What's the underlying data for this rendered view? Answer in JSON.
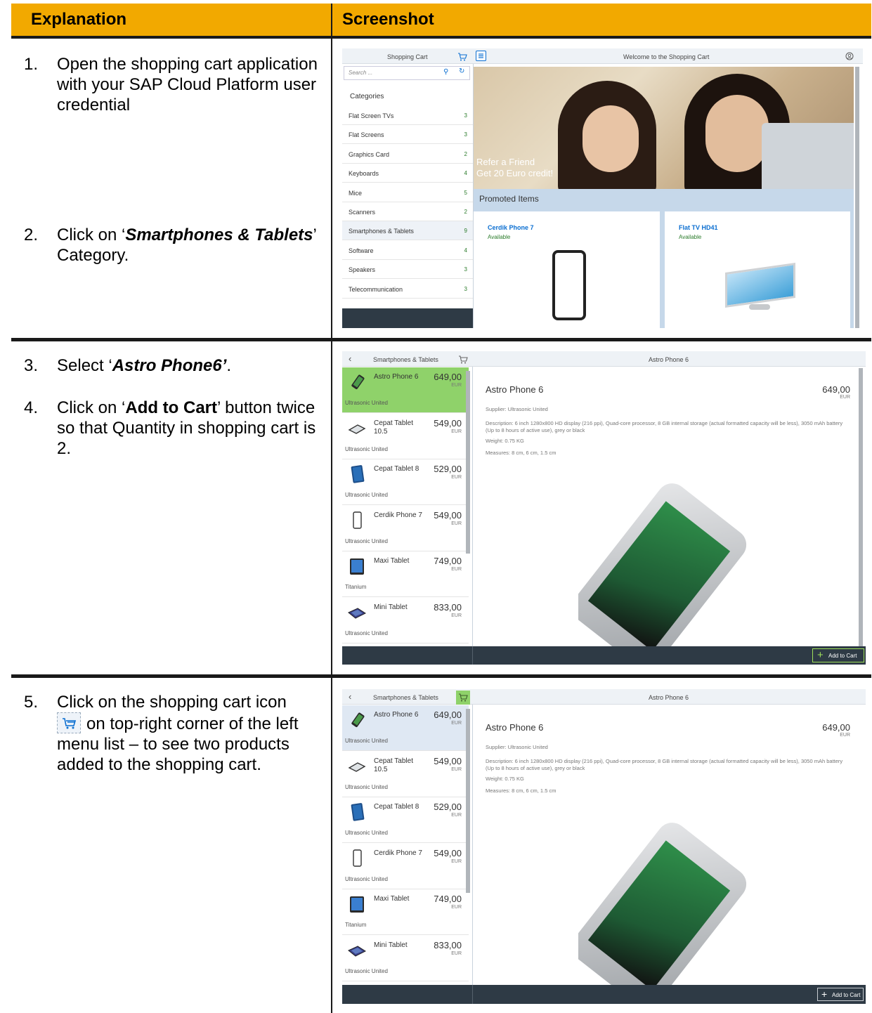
{
  "table": {
    "col1": "Explanation",
    "col2": "Screenshot"
  },
  "steps": [
    {
      "num": "1.",
      "text": "Open the shopping cart application with your SAP Cloud Platform user credential"
    },
    {
      "num": "2.",
      "pre": "Click on ‘",
      "em": "Smartphones & Tablets",
      "post": "’ Category."
    },
    {
      "num": "3.",
      "pre": "Select ‘",
      "em": "Astro Phone6’",
      "post": "."
    },
    {
      "num": "4.",
      "pre": "Click on ‘",
      "strong": "Add to Cart",
      "post": "’ button twice so that Quantity in shopping cart is 2."
    },
    {
      "num": "5.",
      "pre": "Click on the shopping cart icon",
      "post": "on top-right corner of the left menu list – to see two products added to the shopping cart."
    }
  ],
  "shot1": {
    "side_title": "Shopping Cart",
    "main_title": "Welcome to the Shopping Cart",
    "search_placeholder": "Search ...",
    "categories_label": "Categories",
    "categories": [
      {
        "name": "Flat Screen TVs",
        "count": "3"
      },
      {
        "name": "Flat Screens",
        "count": "3"
      },
      {
        "name": "Graphics Card",
        "count": "2"
      },
      {
        "name": "Keyboards",
        "count": "4"
      },
      {
        "name": "Mice",
        "count": "5"
      },
      {
        "name": "Scanners",
        "count": "2"
      },
      {
        "name": "Smartphones & Tablets",
        "count": "9"
      },
      {
        "name": "Software",
        "count": "4"
      },
      {
        "name": "Speakers",
        "count": "3"
      },
      {
        "name": "Telecommunication",
        "count": "3"
      }
    ],
    "hero_line1": "Refer a Friend",
    "hero_line2": "Get 20 Euro credit!",
    "promoted_label": "Promoted Items",
    "promo": [
      {
        "name": "Cerdik Phone 7",
        "status": "Available"
      },
      {
        "name": "Flat TV HD41",
        "status": "Available"
      }
    ]
  },
  "list": {
    "title": "Smartphones & Tablets",
    "detail_header": "Astro Phone 6",
    "items": [
      {
        "name": "Astro Phone 6",
        "price": "649,00",
        "currency": "EUR",
        "supplier": "Ultrasonic United"
      },
      {
        "name": "Cepat Tablet 10.5",
        "price": "549,00",
        "currency": "EUR",
        "supplier": "Ultrasonic United"
      },
      {
        "name": "Cepat Tablet 8",
        "price": "529,00",
        "currency": "EUR",
        "supplier": "Ultrasonic United"
      },
      {
        "name": "Cerdik Phone 7",
        "price": "549,00",
        "currency": "EUR",
        "supplier": "Ultrasonic United"
      },
      {
        "name": "Maxi Tablet",
        "price": "749,00",
        "currency": "EUR",
        "supplier": "Titanium"
      },
      {
        "name": "Mini Tablet",
        "price": "833,00",
        "currency": "EUR",
        "supplier": "Ultrasonic United"
      }
    ],
    "detail": {
      "name": "Astro Phone 6",
      "price": "649,00",
      "currency": "EUR",
      "supplier": "Supplier: Ultrasonic United",
      "description": "Description: 6 inch 1280x800 HD display (216 ppi), Quad-core processor, 8 GB internal storage (actual formatted capacity will be less), 3050 mAh battery (Up to 8 hours of active use), grey or black",
      "weight": "Weight: 0.75 KG",
      "measures": "Measures: 8 cm, 6 cm, 1.5 cm"
    },
    "add_to_cart": "Add to Cart"
  },
  "colors": {
    "header": "#f2a900",
    "selected": "#8fd26a",
    "selected2": "#dfe8f3",
    "link": "#0a6ed1",
    "available": "#2b7c2b",
    "footer": "#2e3a45"
  }
}
